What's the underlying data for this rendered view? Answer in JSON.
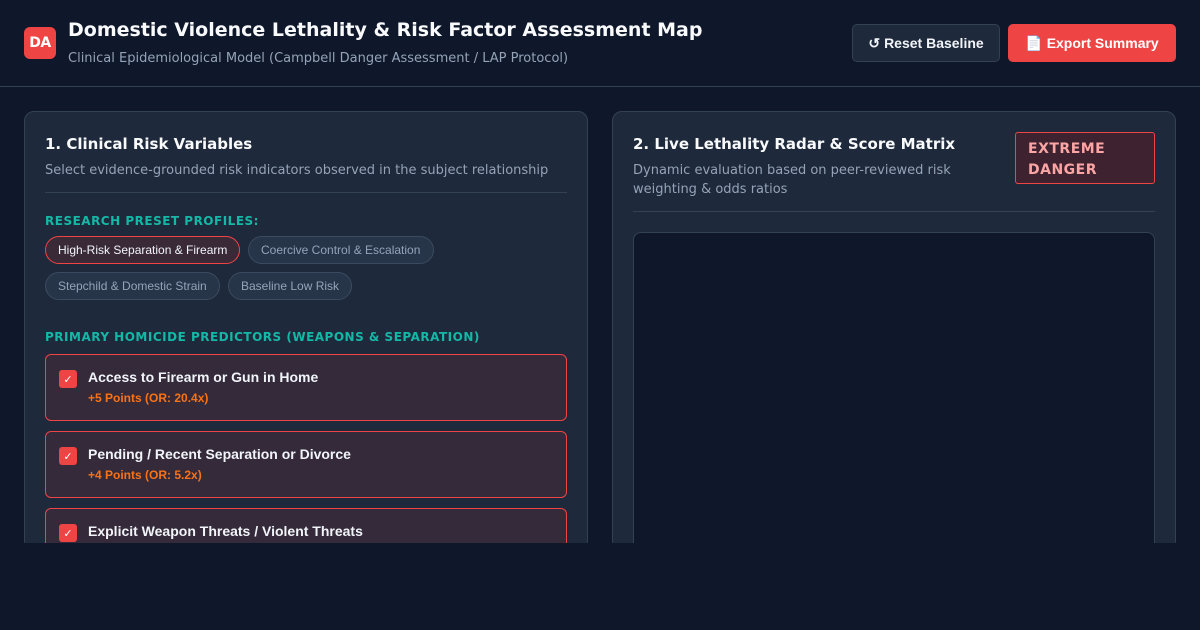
{
  "header": {
    "logo": "DA",
    "title": "Domestic Violence Lethality & Risk Factor Assessment Map",
    "subtitle": "Clinical Epidemiological Model (Campbell Danger Assessment / LAP Protocol)",
    "reset_icon": "↺",
    "reset_label": "Reset Baseline",
    "export_icon": "📄",
    "export_label": "Export Summary"
  },
  "left_panel": {
    "title": "1. Clinical Risk Variables",
    "subtitle": "Select evidence-grounded risk indicators observed in the subject relationship",
    "presets_label": "RESEARCH PRESET PROFILES:",
    "presets": [
      {
        "label": "High-Risk Separation & Firearm",
        "active": true
      },
      {
        "label": "Coercive Control & Escalation",
        "active": false
      },
      {
        "label": "Stepchild & Domestic Strain",
        "active": false
      },
      {
        "label": "Baseline Low Risk",
        "active": false
      }
    ],
    "predictors_label": "PRIMARY HOMICIDE PREDICTORS (WEAPONS & SEPARATION)",
    "check_glyph": "✓",
    "predictors": [
      {
        "name": "Access to Firearm or Gun in Home",
        "points": "+5 Points (OR: 20.4x)",
        "checked": true
      },
      {
        "name": "Pending / Recent Separation or Divorce",
        "points": "+4 Points (OR: 5.2x)",
        "checked": true
      },
      {
        "name": "Explicit Weapon Threats / Violent Threats",
        "points": "",
        "checked": true
      }
    ]
  },
  "right_panel": {
    "title": "2. Live Lethality Radar & Score Matrix",
    "subtitle": "Dynamic evaluation based on peer-reviewed risk weighting & odds ratios",
    "badge": "EXTREME DANGER",
    "colors": {
      "danger": "#ef4444",
      "accent": "#14b8a6",
      "points": "#f97316"
    }
  }
}
